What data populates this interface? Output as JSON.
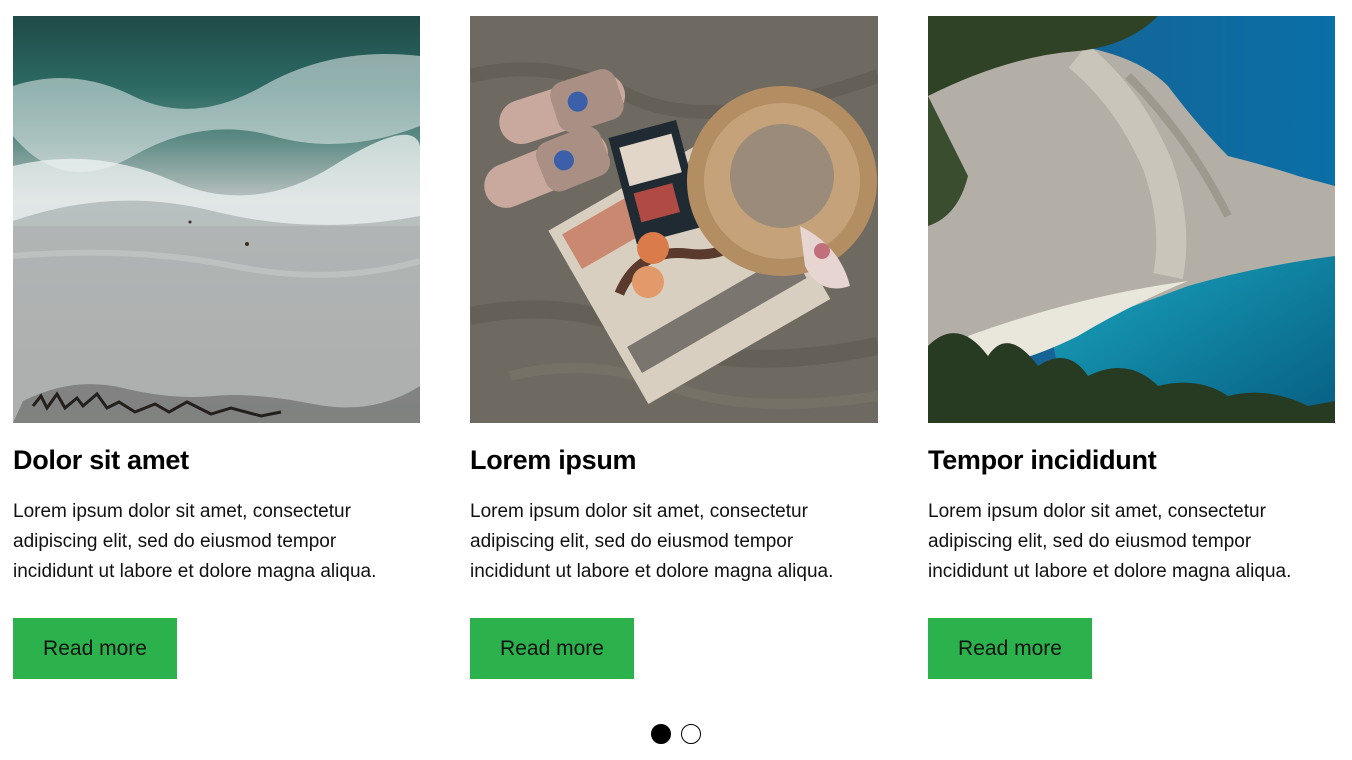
{
  "cards": [
    {
      "image_name": "aerial-beach-waves-image",
      "title": "Dolor sit amet",
      "description": "Lorem ipsum dolor sit amet, consectetur adipiscing elit, sed do eiusmod tempor incididunt ut labore et dolore magna aliqua.",
      "button_label": "Read more"
    },
    {
      "image_name": "sandals-hat-on-sand-image",
      "title": "Lorem ipsum",
      "description": "Lorem ipsum dolor sit amet, consectetur adipiscing elit, sed do eiusmod tempor incididunt ut labore et dolore magna aliqua.",
      "button_label": "Read more"
    },
    {
      "image_name": "cliff-turquoise-bay-image",
      "title": "Tempor incididunt",
      "description": "Lorem ipsum dolor sit amet, consectetur adipiscing elit, sed do eiusmod tempor incididunt ut labore et dolore magna aliqua.",
      "button_label": "Read more"
    }
  ],
  "pagination": {
    "pages": 2,
    "active_page": 1
  },
  "colors": {
    "button": "#2bb24c",
    "dot_active": "#000000"
  }
}
